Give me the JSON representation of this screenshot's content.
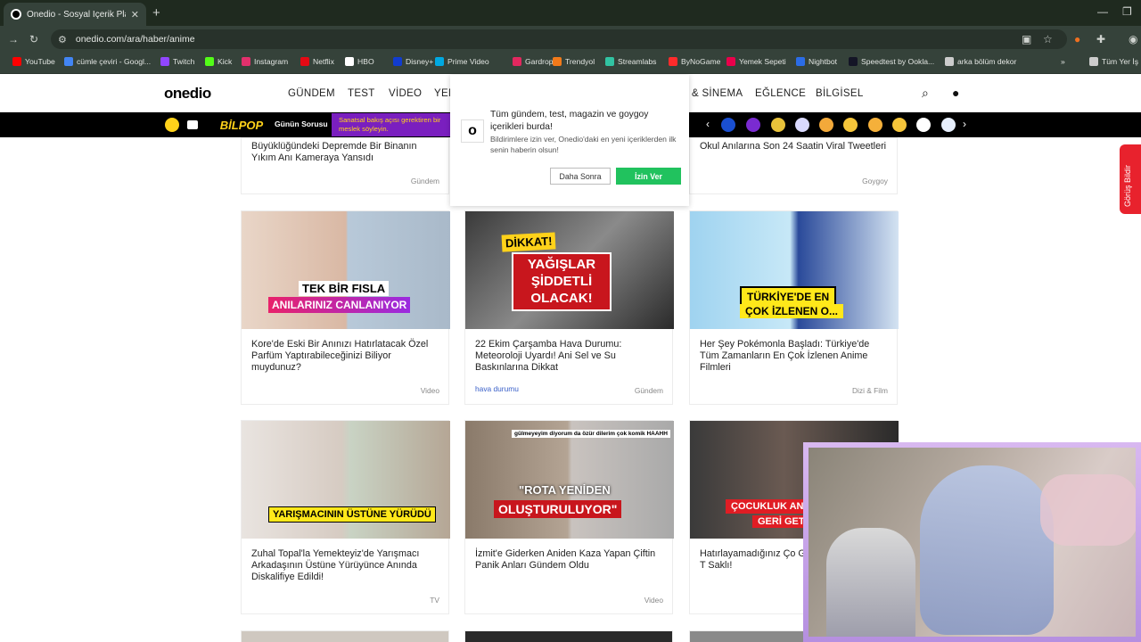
{
  "browser": {
    "tab_title": "Onedio - Sosyal İçerik Platformu",
    "url": "onedio.com/ara/haber/anime",
    "bookmarks": [
      {
        "label": "YouTube",
        "color": "#ff0000"
      },
      {
        "label": "cümle çeviri - Googl...",
        "color": "#4285f4"
      },
      {
        "label": "Twitch",
        "color": "#9146ff"
      },
      {
        "label": "Kick",
        "color": "#53fc18"
      },
      {
        "label": "Instagram",
        "color": "#e1306c"
      },
      {
        "label": "Netflix",
        "color": "#e50914"
      },
      {
        "label": "HBO",
        "color": "#ffffff"
      },
      {
        "label": "Disney+",
        "color": "#113ccf"
      },
      {
        "label": "Prime Video",
        "color": "#00a8e1"
      },
      {
        "label": "Gardrops",
        "color": "#e2285f"
      },
      {
        "label": "Trendyol",
        "color": "#f27a1a"
      },
      {
        "label": "Streamlabs",
        "color": "#31c3a2"
      },
      {
        "label": "ByNoGame",
        "color": "#ff2b2b"
      },
      {
        "label": "Yemek Sepeti",
        "color": "#ea004b"
      },
      {
        "label": "Nightbot",
        "color": "#2b6ce6"
      },
      {
        "label": "Speedtest by Ookla...",
        "color": "#141526"
      },
      {
        "label": "arka bölüm dekor",
        "color": "#cccccc"
      },
      {
        "label": "Tüm Yer İş",
        "color": "#cccccc"
      }
    ]
  },
  "site": {
    "logo": "onedio",
    "nav": [
      "GÜNDEM",
      "TEST",
      "VİDEO",
      "YEN",
      "& SİNEMA",
      "EĞLENCE",
      "BİLGİSEL"
    ],
    "bilpop": "BİLPOP",
    "gunun_sorusu": "Günün Sorusu",
    "sanatsal": "Sanatsal bakış açısı gerektiren bir meslek söyleyin.",
    "feedback": "Görüş Bildir"
  },
  "notification": {
    "title": "Tüm gündem, test, magazin ve goygoy içerikleri burda!",
    "desc": "Bildirimlere izin ver, Onedio'daki en yeni içeriklerden ilk senin haberin olsun!",
    "later": "Daha Sonra",
    "allow": "İzin Ver"
  },
  "cards_top": [
    {
      "title": "Büyüklüğündeki Depremde Bir Binanın Yıkım Anı Kameraya Yansıdı",
      "category": "Gündem"
    },
    {
      "title": "Okul Anılarına Son 24 Saatin Viral Tweetleri",
      "category": "Goygoy"
    }
  ],
  "cards": [
    {
      "title": "Kore'de Eski Bir Anınızı Hatırlatacak Özel Parfüm Yaptırabileceğinizi Biliyor muydunuz?",
      "category": "Video",
      "tag": "",
      "caption1": "TEK BİR FISLA",
      "caption2": "ANILARINIZ CANLANIYOR"
    },
    {
      "title": "22 Ekim Çarşamba Hava Durumu: Meteoroloji Uyardı! Ani Sel ve Su Baskınlarına Dikkat",
      "category": "Gündem",
      "tag": "hava durumu",
      "caption1": "DİKKAT!",
      "caption2": "YAĞIŞLAR ŞİDDETLİ OLACAK!"
    },
    {
      "title": "Her Şey Pokémonla Başladı: Türkiye'de Tüm Zamanların En Çok İzlenen Anime Filmleri",
      "category": "Dizi & Film",
      "tag": "",
      "caption1": "TÜRKİYE'DE EN",
      "caption2": "ÇOK İZLENEN O..."
    },
    {
      "title": "Zuhal Topal'la Yemekteyiz'de Yarışmacı Arkadaşının Üstüne Yürüyünce Anında Diskalifiye Edildi!",
      "category": "TV",
      "tag": "",
      "caption1": "YARIŞMACININ ÜSTÜNE YÜRÜDÜ",
      "caption2": ""
    },
    {
      "title": "İzmit'e Giderken Aniden Kaza Yapan Çiftin Panik Anları Gündem Oldu",
      "category": "Video",
      "tag": "",
      "caption1": "\"ROTA YENİDEN",
      "caption2": "OLUŞTURULUYOR\""
    },
    {
      "title": "Hatırlayamadığınız Ço Geri Getirmenin Sırrı T Saklı!",
      "category": "",
      "tag": "",
      "caption1": "ÇOCUKLUK AN",
      "caption2": "GERİ GETİ"
    }
  ],
  "thumb_small_text": "gülmeyeyim diyorum da özür dilerim çok komik HAAHH"
}
